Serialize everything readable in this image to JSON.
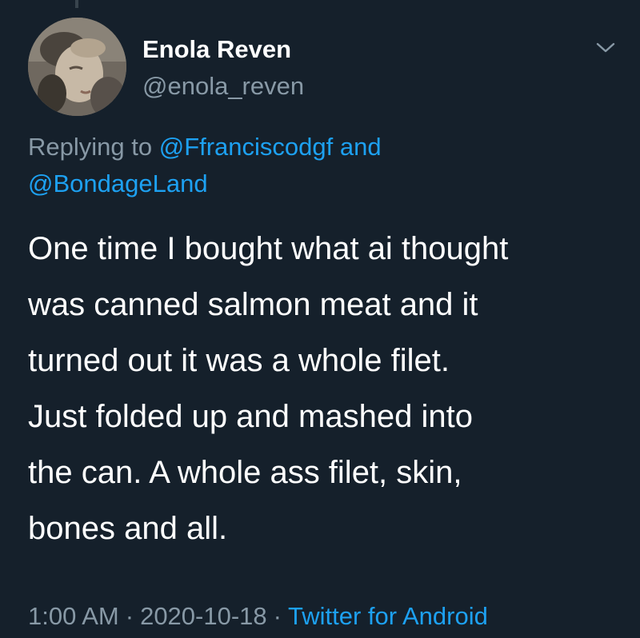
{
  "author": {
    "display_name": "Enola Reven",
    "handle": "@enola_reven"
  },
  "reply": {
    "prefix": "Replying to",
    "mention_1": "@Ffranciscodgf",
    "connector": "and",
    "mention_2": "@BondageLand"
  },
  "tweet": {
    "lines": [
      "One time I bought what ai thought",
      "was canned salmon meat and it",
      "turned out it was a whole filet.",
      "Just folded up and mashed into",
      "the can. A whole ass filet, skin,",
      "bones and all."
    ]
  },
  "meta": {
    "time": "1:00 AM",
    "separator": "·",
    "date": "2020-10-18",
    "source": "Twitter for Android"
  },
  "icons": {
    "menu": "chevron-down-icon"
  },
  "colors": {
    "background": "#15202b",
    "text": "#ffffff",
    "secondary": "#8899a6",
    "accent": "#1da1f2"
  }
}
